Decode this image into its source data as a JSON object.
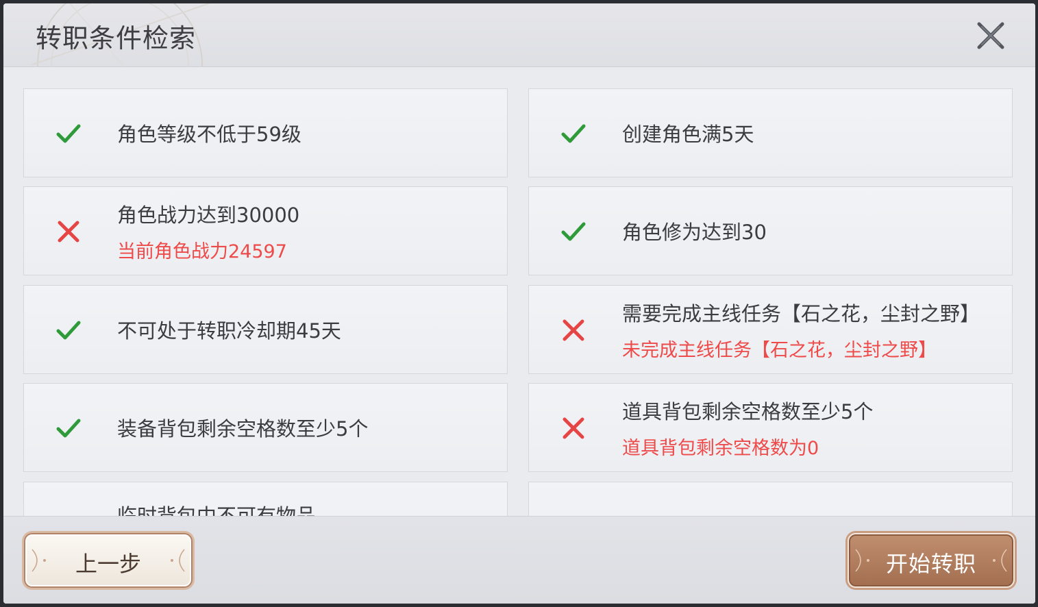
{
  "header": {
    "title": "转职条件检索"
  },
  "colors": {
    "check": "#2e9a3a",
    "cross": "#e64545",
    "unmet_text": "#ee4a4a"
  },
  "conditions": [
    {
      "status": "met",
      "icon": "check-icon",
      "label": "角色等级不低于59级",
      "detail": ""
    },
    {
      "status": "met",
      "icon": "check-icon",
      "label": "创建角色满5天",
      "detail": ""
    },
    {
      "status": "unmet",
      "icon": "cross-icon",
      "label": "角色战力达到30000",
      "detail": "当前角色战力24597"
    },
    {
      "status": "met",
      "icon": "check-icon",
      "label": "角色修为达到30",
      "detail": ""
    },
    {
      "status": "met",
      "icon": "check-icon",
      "label": "不可处于转职冷却期45天",
      "detail": ""
    },
    {
      "status": "unmet",
      "icon": "cross-icon",
      "label": "需要完成主线任务【石之花，尘封之野】",
      "detail": "未完成主线任务【石之花，尘封之野】"
    },
    {
      "status": "met",
      "icon": "check-icon",
      "label": "装备背包剩余空格数至少5个",
      "detail": ""
    },
    {
      "status": "unmet",
      "icon": "cross-icon",
      "label": "道具背包剩余空格数至少5个",
      "detail": "道具背包剩余空格数为0"
    },
    {
      "status": "",
      "icon": "",
      "label": "临时背包中不可有物品",
      "detail": ""
    },
    {
      "status": "",
      "icon": "",
      "label": "",
      "detail": ""
    }
  ],
  "footer": {
    "prev_label": "上一步",
    "start_label": "开始转职"
  }
}
